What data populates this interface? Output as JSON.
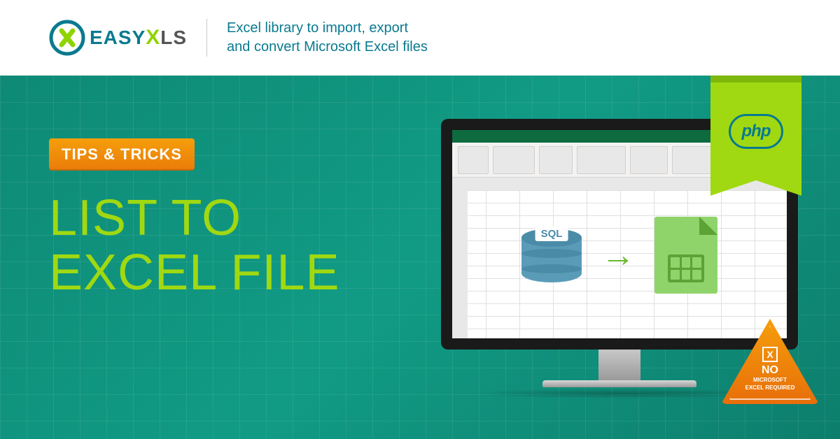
{
  "header": {
    "brand_easy": "EASY",
    "brand_x": "X",
    "brand_ls": "LS",
    "tagline_l1": "Excel library to import, export",
    "tagline_l2": "and convert Microsoft Excel files"
  },
  "ribbon": {
    "label": "php"
  },
  "content": {
    "badge": "TIPS & TRICKS",
    "title_l1": "LIST TO",
    "title_l2": "EXCEL FILE"
  },
  "diagram": {
    "db_label": "SQL",
    "arrow": "→"
  },
  "warning": {
    "x": "X",
    "no": "NO",
    "sub_l1": "MICROSOFT",
    "sub_l2": "EXCEL REQUIRED"
  }
}
